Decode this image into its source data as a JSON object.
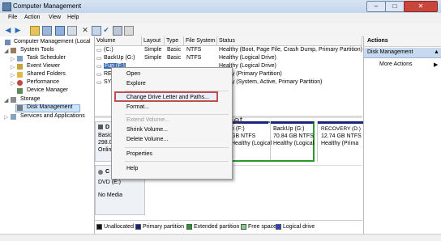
{
  "window": {
    "title": "Computer Management",
    "controls": [
      "–",
      "□",
      "✕"
    ]
  },
  "menu": [
    "File",
    "Action",
    "View",
    "Help"
  ],
  "tree": {
    "root": "Computer Management (Local",
    "system_tools": "System Tools",
    "task_scheduler": "Task Scheduler",
    "event_viewer": "Event Viewer",
    "shared_folders": "Shared Folders",
    "performance": "Performance",
    "device_manager": "Device Manager",
    "storage": "Storage",
    "disk_management": "Disk Management",
    "services": "Services and Applications"
  },
  "columns": [
    "Volume",
    "Layout",
    "Type",
    "File System",
    "Status"
  ],
  "volumes": [
    {
      "name": "(C:)",
      "layout": "Simple",
      "type": "Basic",
      "fs": "NTFS",
      "status": "Healthy (Boot, Page File, Crash Dump, Primary Partition)"
    },
    {
      "name": "BackUp (G:)",
      "layout": "Simple",
      "type": "Basic",
      "fs": "NTFS",
      "status": "Healthy (Logical Drive)"
    },
    {
      "name": "Fun (F:)",
      "layout": "",
      "type": "",
      "fs": "",
      "status": "Healthy (Logical Drive)"
    },
    {
      "name": "RE",
      "layout": "",
      "type": "",
      "fs": "",
      "status": "thy (Primary Partition)"
    },
    {
      "name": "SYS",
      "layout": "",
      "type": "",
      "fs": "",
      "status": "thy (System, Active, Primary Partition)"
    }
  ],
  "context_menu": {
    "open": "Open",
    "explore": "Explore",
    "change_drive": "Change Drive Letter and Paths...",
    "format": "Format...",
    "extend": "Extend Volume...",
    "shrink": "Shrink Volume...",
    "delete": "Delete Volume...",
    "properties": "Properties",
    "help": "Help"
  },
  "disk0": {
    "label": "D",
    "line1": "Basic",
    "line2": "298.0",
    "line3": "Onlin",
    "partitions": [
      {
        "title": "n  (F:)",
        "size": "GB NTFS",
        "status": "Healthy (Logical"
      },
      {
        "title": "BackUp (G:)",
        "size": "70.84 GB NTFS",
        "status": "Healthy (Logical"
      },
      {
        "title": "RECOVERY (D:)",
        "size": "12.74 GB NTFS",
        "status": "Healthy (Prima"
      }
    ]
  },
  "cdrom": {
    "label": "C",
    "line1": "DVD (E:)",
    "line2": "No Media"
  },
  "watermark": "techrena.net",
  "legend": {
    "unallocated": "Unallocated",
    "primary": "Primary partition",
    "extended": "Extended partition",
    "free": "Free space",
    "logical": "Logical drive"
  },
  "actions": {
    "header": "Actions",
    "section": "Disk Management",
    "more": "More Actions"
  }
}
